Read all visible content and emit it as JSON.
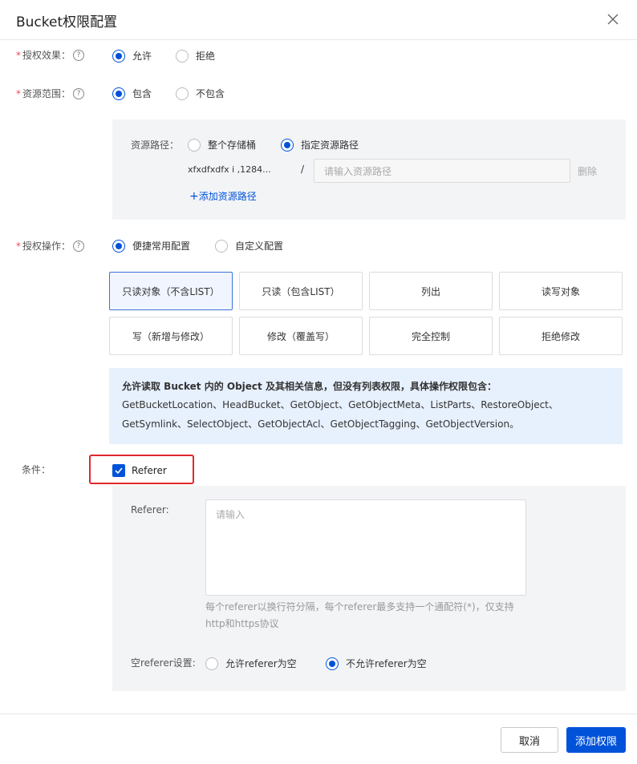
{
  "dialog": {
    "title": "Bucket权限配置",
    "close_icon": "close-icon"
  },
  "effect": {
    "label": "授权效果：",
    "required": "*",
    "options": [
      "允许",
      "拒绝"
    ],
    "selected": "允许"
  },
  "scope": {
    "label": "资源范围：",
    "required": "*",
    "options": [
      "包含",
      "不包含"
    ],
    "selected": "包含"
  },
  "resource_path": {
    "label": "资源路径：",
    "options": [
      "整个存储桶",
      "指定资源路径"
    ],
    "selected": "指定资源路径",
    "bucket_prefix": "xfxdfxdfx i   ,1284...",
    "separator": "/",
    "placeholder": "请输入资源路径",
    "delete_label": "删除",
    "add_label": "添加资源路径",
    "add_icon": "plus-icon"
  },
  "operation": {
    "label": "授权操作：",
    "required": "*",
    "options": [
      "便捷常用配置",
      "自定义配置"
    ],
    "selected": "便捷常用配置",
    "buttons": [
      "只读对象（不含LIST）",
      "只读（包含LIST）",
      "列出",
      "读写对象",
      "写（新增与修改）",
      "修改（覆盖写）",
      "完全控制",
      "拒绝修改"
    ],
    "active_button": "只读对象（不含LIST）"
  },
  "info": {
    "lead": "允许读取 Bucket 内的 Object 及其相关信息，但没有列表权限，具体操作权限包含：",
    "actions": "GetBucketLocation、HeadBucket、GetObject、GetObjectMeta、ListParts、RestoreObject、GetSymlink、SelectObject、GetObjectAcl、GetObjectTagging、GetObjectVersion。"
  },
  "condition": {
    "label": "条件：",
    "checkbox_label": "Referer",
    "checked": true,
    "referer_label": "Referer:",
    "placeholder": "请输入",
    "hint": "每个referer以换行符分隔，每个referer最多支持一个通配符(*)，仅支持http和https协议",
    "empty_label": "空referer设置:",
    "empty_options": [
      "允许referer为空",
      "不允许referer为空"
    ],
    "empty_selected": "不允许referer为空"
  },
  "footer": {
    "cancel_label": "取消",
    "submit_label": "添加权限"
  },
  "colors": {
    "primary": "#0052d9",
    "required": "#e34d59",
    "highlight_border": "#e0282e",
    "info_bg": "#e7f0fd"
  }
}
